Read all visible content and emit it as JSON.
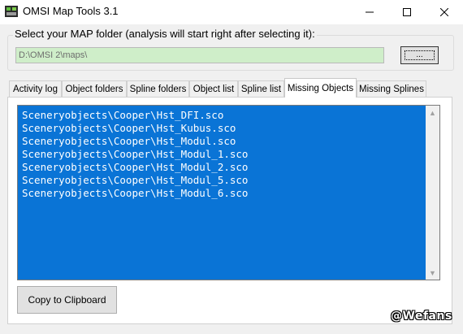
{
  "window": {
    "title": "OMSI Map Tools 3.1",
    "controls": {
      "minimize_icon": "minimize-icon",
      "maximize_icon": "maximize-icon",
      "close_icon": "close-icon"
    }
  },
  "folder": {
    "label": "Select your MAP folder (analysis will start right after selecting it):",
    "path_value": "D:\\OMSI 2\\maps\\",
    "browse_label": "..."
  },
  "tabs": [
    {
      "label": "Activity log",
      "active": false
    },
    {
      "label": "Object folders",
      "active": false
    },
    {
      "label": "Spline folders",
      "active": false
    },
    {
      "label": "Object list",
      "active": false
    },
    {
      "label": "Spline list",
      "active": false
    },
    {
      "label": "Missing Objects",
      "active": true
    },
    {
      "label": "Missing Splines",
      "active": false
    }
  ],
  "missing_objects": {
    "items": [
      "Sceneryobjects\\Cooper\\Hst_DFI.sco",
      "Sceneryobjects\\Cooper\\Hst_Kubus.sco",
      "Sceneryobjects\\Cooper\\Hst_Modul.sco",
      "Sceneryobjects\\Cooper\\Hst_Modul_1.sco",
      "Sceneryobjects\\Cooper\\Hst_Modul_2.sco",
      "Sceneryobjects\\Cooper\\Hst_Modul_5.sco",
      "Sceneryobjects\\Cooper\\Hst_Modul_6.sco"
    ],
    "copy_button": "Copy to Clipboard"
  },
  "watermark": "@Wefans",
  "colors": {
    "selection": "#0a74d6",
    "path_field": "#cfeec9"
  }
}
